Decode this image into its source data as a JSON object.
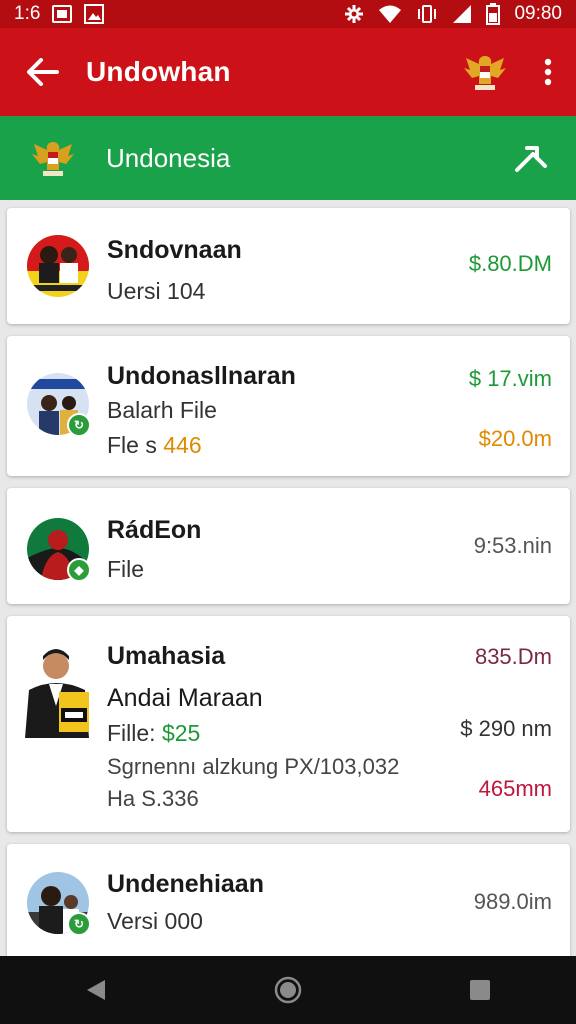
{
  "status_bar": {
    "left_text": "1:6",
    "time": "09:80"
  },
  "app_bar": {
    "title": "Undowhan",
    "icons": [
      "back-arrow-icon",
      "garuda-emblem-icon",
      "more-vert-icon"
    ]
  },
  "sub_bar": {
    "title": "Undonesia",
    "icons": [
      "garuda-emblem-icon",
      "share-arrow-icon"
    ]
  },
  "items": [
    {
      "title": "Sndovnaan",
      "line1": "Uersi 104",
      "right1": "$.80.DM"
    },
    {
      "title": "Undonasllnaran",
      "line1": "Balarh File",
      "line2_prefix": "Fle s ",
      "line2_highlight": "446",
      "right1": "$ 17.vim",
      "right2": "$20.0m"
    },
    {
      "title": "RádEon",
      "line1": "File",
      "right1": "9:53.nin"
    },
    {
      "title": "Umahasia",
      "line1": "Andai Maraan",
      "line2_prefix": "Fille: ",
      "line2_highlight": "$25",
      "line3": "Sgrnennı alzkung PX/103,032",
      "line4": "Ha S.336",
      "right1": "835.Dm",
      "right2": "$ 290 nm",
      "right3": "465mm"
    },
    {
      "title": "Undenehiaan",
      "line1": "Versi 000",
      "right1": "989.0im"
    }
  ],
  "colors": {
    "status_bar": "#b30d12",
    "app_bar": "#cc1118",
    "sub_bar": "#1aa24a",
    "green_amount": "#1d9a35",
    "orange_amount": "#e08a00",
    "crimson_amount": "#c0163e"
  }
}
